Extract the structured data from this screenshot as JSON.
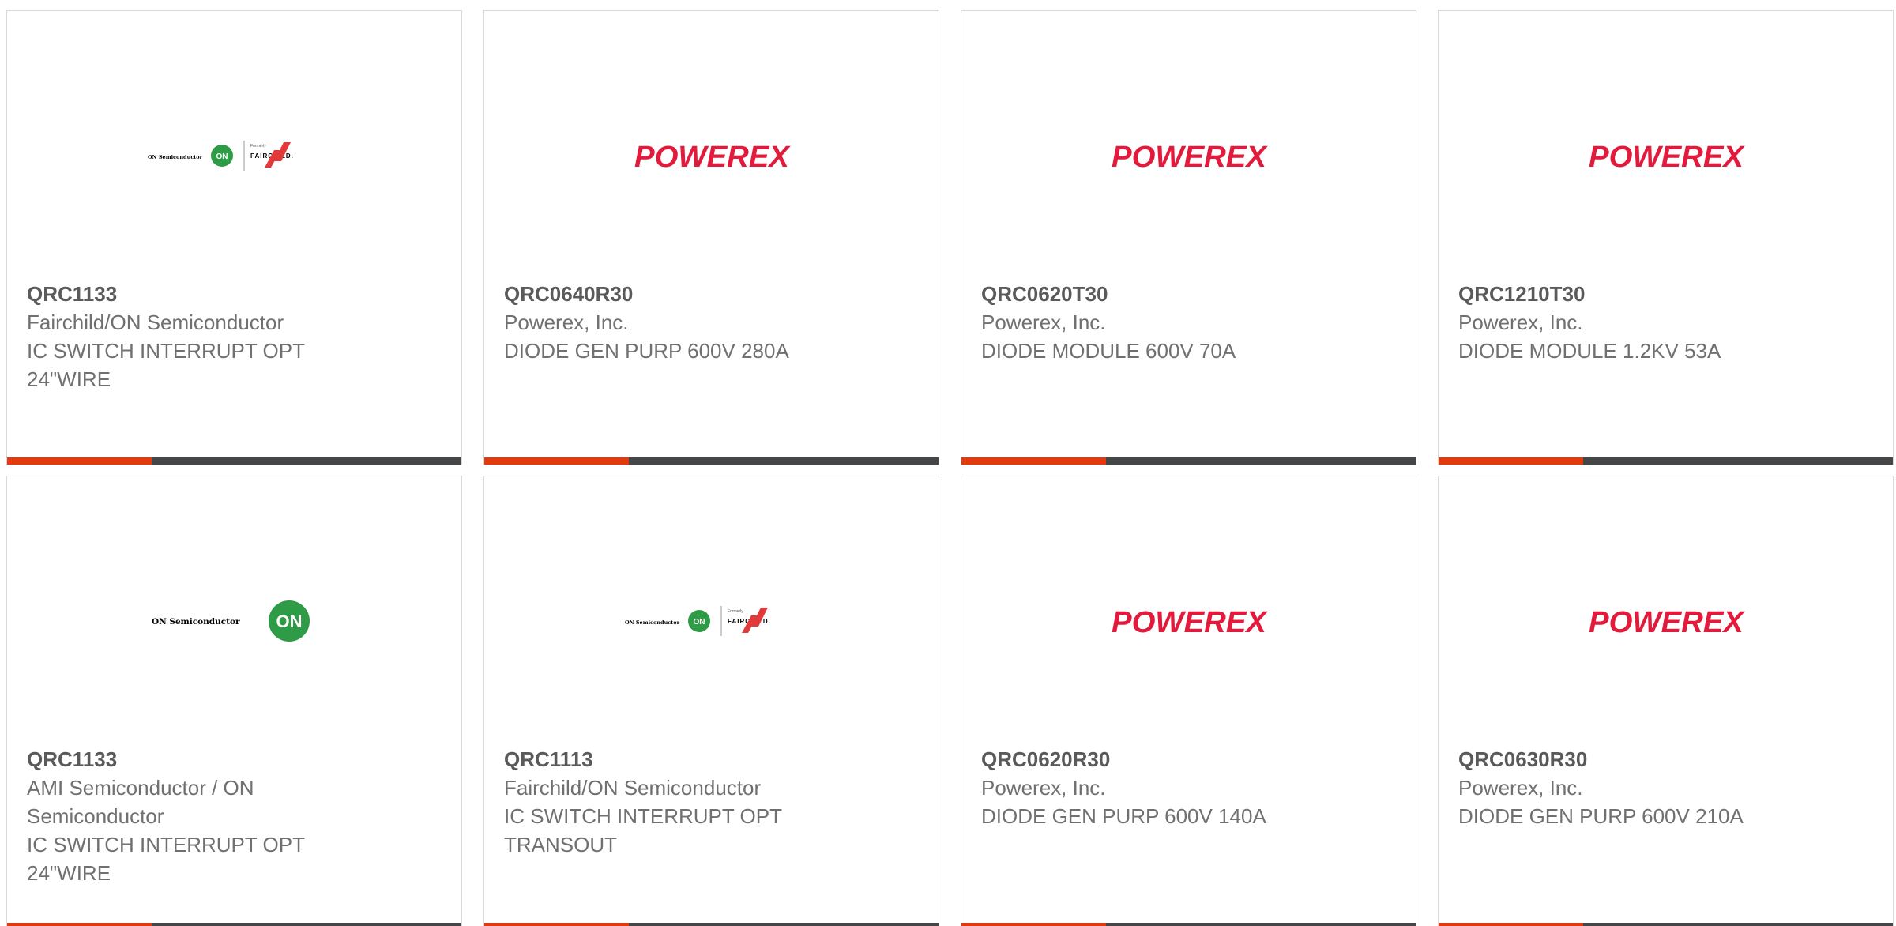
{
  "colors": {
    "accent_bar": "#e23a0e",
    "dark_bar": "#444648",
    "powerex_red": "#e21b3c",
    "on_green": "#2e9b46"
  },
  "products": [
    {
      "part": "QRC1133",
      "manufacturer": "Fairchild/ON Semiconductor",
      "description": "IC SWITCH INTERRUPT OPT 24\"WIRE",
      "logo": {
        "type": "on-fairchild",
        "on_name": "ON Semiconductor",
        "badge": "ON",
        "formerly": "Formerly",
        "fairchild": "FAIRCHILD."
      }
    },
    {
      "part": "QRC0640R30",
      "manufacturer": "Powerex, Inc.",
      "description": "DIODE GEN PURP 600V 280A",
      "logo": {
        "type": "powerex",
        "text": "POWEREX"
      }
    },
    {
      "part": "QRC0620T30",
      "manufacturer": "Powerex, Inc.",
      "description": "DIODE MODULE 600V 70A",
      "logo": {
        "type": "powerex",
        "text": "POWEREX"
      }
    },
    {
      "part": "QRC1210T30",
      "manufacturer": "Powerex, Inc.",
      "description": "DIODE MODULE 1.2KV 53A",
      "logo": {
        "type": "powerex",
        "text": "POWEREX"
      }
    },
    {
      "part": "QRC1133",
      "manufacturer": "AMI Semiconductor / ON Semiconductor",
      "description": "IC SWITCH INTERRUPT OPT 24\"WIRE",
      "logo": {
        "type": "on",
        "on_name": "ON Semiconductor",
        "badge": "ON"
      }
    },
    {
      "part": "QRC1113",
      "manufacturer": "Fairchild/ON Semiconductor",
      "description": "IC SWITCH INTERRUPT OPT TRANSOUT",
      "logo": {
        "type": "on-fairchild",
        "on_name": "ON Semiconductor",
        "badge": "ON",
        "formerly": "Formerly",
        "fairchild": "FAIRCHILD."
      }
    },
    {
      "part": "QRC0620R30",
      "manufacturer": "Powerex, Inc.",
      "description": "DIODE GEN PURP 600V 140A",
      "logo": {
        "type": "powerex",
        "text": "POWEREX"
      }
    },
    {
      "part": "QRC0630R30",
      "manufacturer": "Powerex, Inc.",
      "description": "DIODE GEN PURP 600V 210A",
      "logo": {
        "type": "powerex",
        "text": "POWEREX"
      }
    }
  ]
}
